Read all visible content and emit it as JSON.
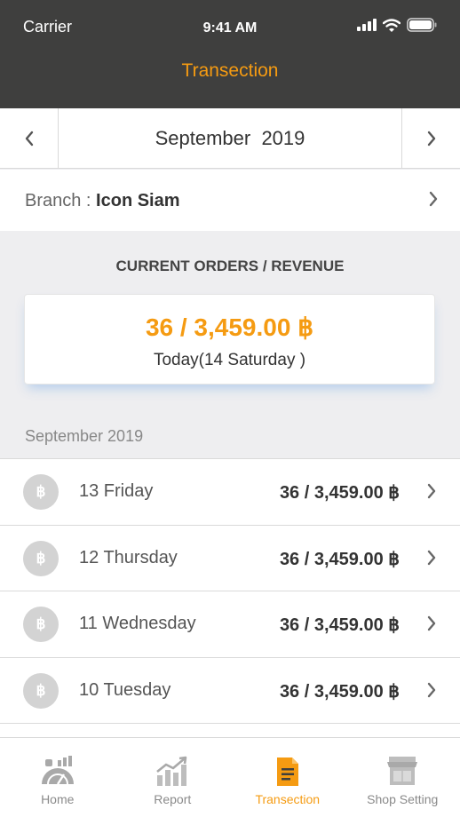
{
  "status_bar": {
    "carrier": "Carrier",
    "time": "9:41 AM"
  },
  "header": {
    "title": "Transection"
  },
  "month_nav": {
    "label": "September  2019"
  },
  "branch": {
    "label": "Branch :",
    "name": "Icon Siam"
  },
  "summary": {
    "title": "CURRENT ORDERS / REVENUE",
    "value": "36 / 3,459.00 ฿",
    "subtitle": "Today(14 Saturday )"
  },
  "list": {
    "header": "September 2019",
    "items": [
      {
        "coin": "฿",
        "day": "13 Friday",
        "amount": "36 / 3,459.00 ฿"
      },
      {
        "coin": "฿",
        "day": "12 Thursday",
        "amount": "36 / 3,459.00 ฿"
      },
      {
        "coin": "฿",
        "day": "11 Wednesday",
        "amount": "36 / 3,459.00 ฿"
      },
      {
        "coin": "฿",
        "day": "10 Tuesday",
        "amount": "36 / 3,459.00 ฿"
      }
    ]
  },
  "tabbar": {
    "tabs": [
      {
        "label": "Home",
        "icon": "home-dashboard-icon"
      },
      {
        "label": "Report",
        "icon": "report-chart-icon"
      },
      {
        "label": "Transection",
        "icon": "document-icon",
        "active": true
      },
      {
        "label": "Shop Setting",
        "icon": "shop-icon"
      }
    ]
  },
  "colors": {
    "accent": "#F59B12",
    "header_bg": "#3F3F3E",
    "page_bg": "#EEEEF0",
    "coin_bg": "#D3D3D3"
  }
}
